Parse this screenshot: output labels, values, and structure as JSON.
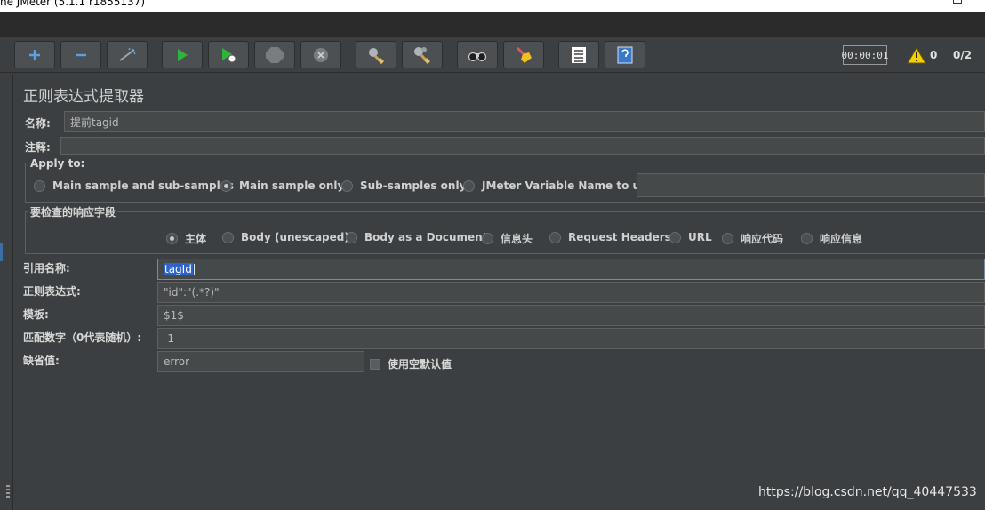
{
  "window": {
    "title": "he JMeter (5.1.1 r1855137)"
  },
  "toolbar": {
    "buttons": [
      {
        "name": "add",
        "icon": "plus-icon"
      },
      {
        "name": "remove",
        "icon": "minus-icon"
      },
      {
        "name": "toggle",
        "icon": "wand-icon"
      },
      {
        "name": "start",
        "icon": "play-icon"
      },
      {
        "name": "start-no-pauses",
        "icon": "play-no-pause-icon"
      },
      {
        "name": "stop",
        "icon": "stop-icon"
      },
      {
        "name": "shutdown",
        "icon": "shutdown-icon"
      },
      {
        "name": "clear",
        "icon": "broom-gear-icon"
      },
      {
        "name": "clear-all",
        "icon": "broom-gear-all-icon"
      },
      {
        "name": "search",
        "icon": "binoculars-icon"
      },
      {
        "name": "reset-search",
        "icon": "broom-icon"
      },
      {
        "name": "function-helper",
        "icon": "list-icon"
      },
      {
        "name": "help",
        "icon": "help-icon"
      }
    ],
    "timer": "00:00:01",
    "warning_count": "0",
    "threads": "0/2"
  },
  "panel": {
    "title": "正则表达式提取器",
    "name_label": "名称:",
    "name_value": "提前tagid",
    "comment_label": "注释:",
    "comment_value": "",
    "apply_to": {
      "title": "Apply to:",
      "options": [
        {
          "label": "Main sample and sub-samples",
          "selected": false
        },
        {
          "label": "Main sample only",
          "selected": true
        },
        {
          "label": "Sub-samples only",
          "selected": false
        },
        {
          "label": "JMeter Variable Name to use",
          "selected": false
        }
      ],
      "variable_value": ""
    },
    "field_to_check": {
      "title": "要检查的响应字段",
      "options": [
        {
          "label": "主体",
          "selected": true
        },
        {
          "label": "Body (unescaped)",
          "selected": false
        },
        {
          "label": "Body as a Document",
          "selected": false
        },
        {
          "label": "信息头",
          "selected": false
        },
        {
          "label": "Request Headers",
          "selected": false
        },
        {
          "label": "URL",
          "selected": false
        },
        {
          "label": "响应代码",
          "selected": false
        },
        {
          "label": "响应信息",
          "selected": false
        }
      ]
    },
    "ref_name_label": "引用名称:",
    "ref_name_value": "tagId",
    "regex_label": "正则表达式:",
    "regex_value": "\"id\":\"(.*?)\"",
    "template_label": "模板:",
    "template_value": "$1$",
    "match_no_label": "匹配数字（0代表随机）:",
    "match_no_value": "-1",
    "default_label": "缺省值:",
    "default_value": "error",
    "use_empty_default_label": "使用空默认值",
    "use_empty_default_checked": false
  },
  "watermark": "https://blog.csdn.net/qq_40447533"
}
